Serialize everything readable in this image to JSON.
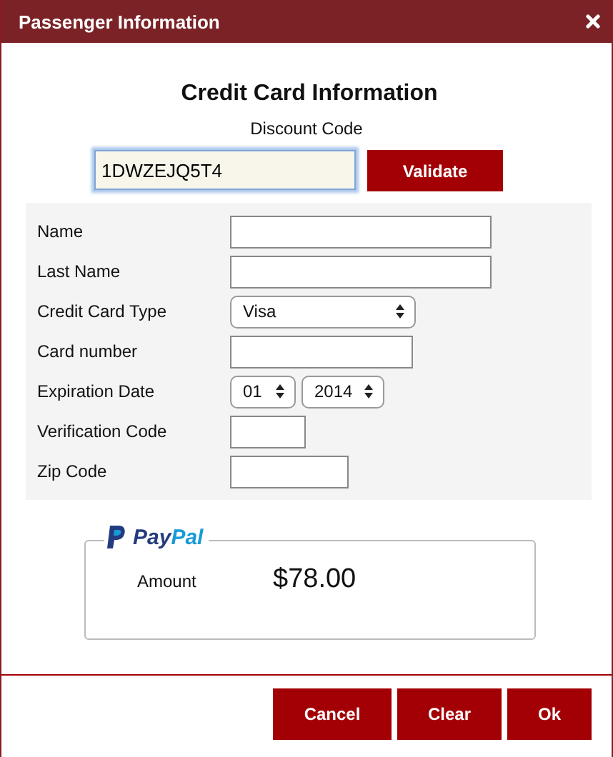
{
  "window": {
    "title": "Passenger Information"
  },
  "heading": "Credit Card Information",
  "discount": {
    "label": "Discount Code",
    "value": "1DWZEJQ5T4",
    "focused": true,
    "button": "Validate"
  },
  "form": {
    "rows": [
      {
        "label": "Name",
        "fields": [
          {
            "kind": "text"
          }
        ]
      },
      {
        "label": "Last Name",
        "fields": [
          {
            "kind": "text"
          }
        ]
      },
      {
        "label": "Credit Card Type",
        "fields": [
          {
            "kind": "select",
            "value": "Visa"
          }
        ]
      },
      {
        "label": "Card number",
        "fields": [
          {
            "kind": "text"
          }
        ]
      },
      {
        "label": "Expiration Date",
        "fields": [
          {
            "kind": "select",
            "value": "01"
          },
          {
            "kind": "select",
            "value": "2014"
          }
        ]
      },
      {
        "label": "Verification Code",
        "fields": [
          {
            "kind": "text"
          }
        ]
      },
      {
        "label": "Zip Code",
        "fields": [
          {
            "kind": "text"
          }
        ]
      }
    ]
  },
  "paypal": {
    "logo": [
      {
        "text": "Pay",
        "color": "#253b80"
      },
      {
        "text": "Pal",
        "color": "#179bd7"
      }
    ],
    "amount_label": "Amount",
    "amount": "$78.00"
  },
  "buttons": [
    "Cancel",
    "Clear",
    "Ok"
  ]
}
